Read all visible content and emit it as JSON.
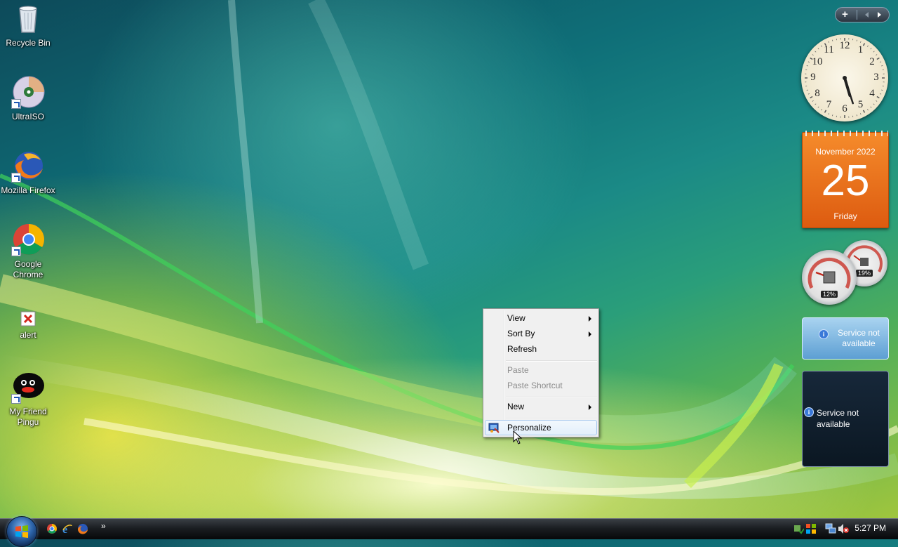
{
  "desktop_icons": [
    {
      "label": "Recycle Bin",
      "icon": "recycle-bin-icon"
    },
    {
      "label": "UltraISO",
      "icon": "ultraiso-icon"
    },
    {
      "label": "Mozilla Firefox",
      "icon": "firefox-icon"
    },
    {
      "label": "Google\nChrome",
      "icon": "chrome-icon"
    },
    {
      "label": "alert",
      "icon": "alert-icon"
    },
    {
      "label": "My Friend\nPingu",
      "icon": "pingu-icon"
    }
  ],
  "context_menu": {
    "items": [
      {
        "label": "View",
        "submenu": true,
        "enabled": true
      },
      {
        "label": "Sort By",
        "submenu": true,
        "enabled": true
      },
      {
        "label": "Refresh",
        "submenu": false,
        "enabled": true
      },
      {
        "label": "Paste",
        "submenu": false,
        "enabled": false
      },
      {
        "label": "Paste Shortcut",
        "submenu": false,
        "enabled": false
      },
      {
        "label": "New",
        "submenu": true,
        "enabled": true
      },
      {
        "label": "Personalize",
        "submenu": false,
        "enabled": true,
        "highlighted": true
      }
    ]
  },
  "sidebar": {
    "clock": {
      "numerals": [
        "12",
        "1",
        "2",
        "3",
        "4",
        "5",
        "6",
        "7",
        "8",
        "9",
        "10",
        "11"
      ],
      "hour": 5,
      "minute": 27
    },
    "calendar": {
      "month_year": "November 2022",
      "day": "25",
      "weekday": "Friday"
    },
    "cpu_meter": {
      "cpu_percent": "12%",
      "memory_percent": "19%"
    },
    "feed_small": {
      "message": "Service not\navailable"
    },
    "feed_large": {
      "message": "Service not\navailable"
    }
  },
  "taskbar": {
    "quick_launch": [
      "chrome-icon",
      "internet-explorer-icon",
      "firefox-icon"
    ],
    "overflow_glyph": "»",
    "clock": "5:27 PM"
  },
  "colors": {
    "calendar_orange": "#e8681a",
    "menu_highlight_border": "#a8c9ee",
    "taskbar_dark": "#1b1e22"
  }
}
